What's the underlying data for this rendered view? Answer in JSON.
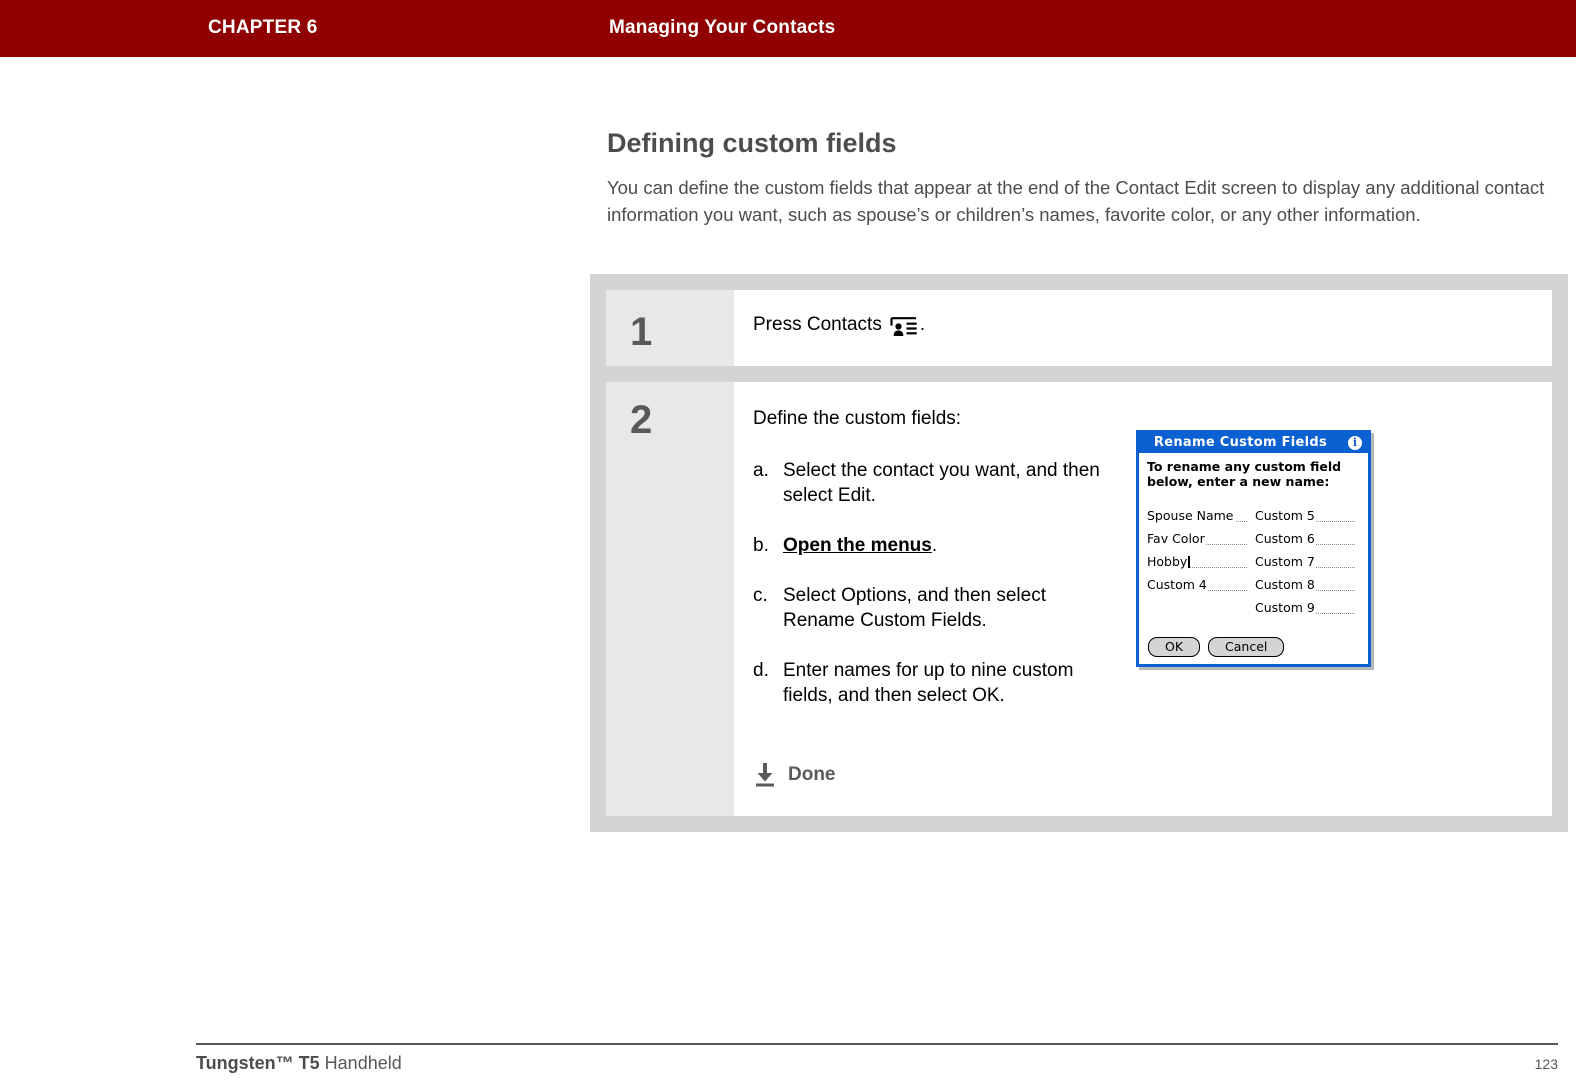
{
  "header": {
    "chapter_label": "CHAPTER 6",
    "chapter_title": "Managing Your Contacts",
    "bar_color": "#900000"
  },
  "content": {
    "heading": "Defining custom fields",
    "intro": "You can define the custom fields that appear at the end of the Contact Edit screen to display any additional contact information you want, such as spouse’s or children’s names, favorite color, or any other information."
  },
  "steps": [
    {
      "number": "1",
      "text_before_icon": "Press Contacts",
      "icon": "contacts-icon",
      "text_after_icon": "."
    },
    {
      "number": "2",
      "intro": "Define the custom fields:",
      "substeps": [
        {
          "marker": "a.",
          "text": "Select the contact you want, and then select Edit."
        },
        {
          "marker": "b.",
          "link_text": "Open the menus",
          "suffix": "."
        },
        {
          "marker": "c.",
          "text": "Select Options, and then select Rename Custom Fields."
        },
        {
          "marker": "d.",
          "text": "Enter names for up to nine custom fields, and then select OK."
        }
      ],
      "done_label": "Done",
      "done_icon": "download-arrow-icon"
    }
  ],
  "dialog": {
    "title": "Rename Custom Fields",
    "info_icon": "info-icon",
    "info_glyph": "i",
    "instruction": "To rename any custom field below, enter a new name:",
    "title_color": "#0b61d1",
    "fields_left": [
      {
        "label": "Spouse Name",
        "has_caret": false
      },
      {
        "label": "Fav Color",
        "has_caret": false
      },
      {
        "label": "Hobby",
        "has_caret": true
      },
      {
        "label": "Custom 4",
        "has_caret": false
      }
    ],
    "fields_right": [
      {
        "label": "Custom 5",
        "has_caret": false
      },
      {
        "label": "Custom 6",
        "has_caret": false
      },
      {
        "label": "Custom 7",
        "has_caret": false
      },
      {
        "label": "Custom 8",
        "has_caret": false
      },
      {
        "label": "Custom 9",
        "has_caret": false
      }
    ],
    "ok_label": "OK",
    "cancel_label": "Cancel"
  },
  "footer": {
    "brand": "Tungsten™ T5",
    "product": " Handheld",
    "page_number": "123"
  }
}
